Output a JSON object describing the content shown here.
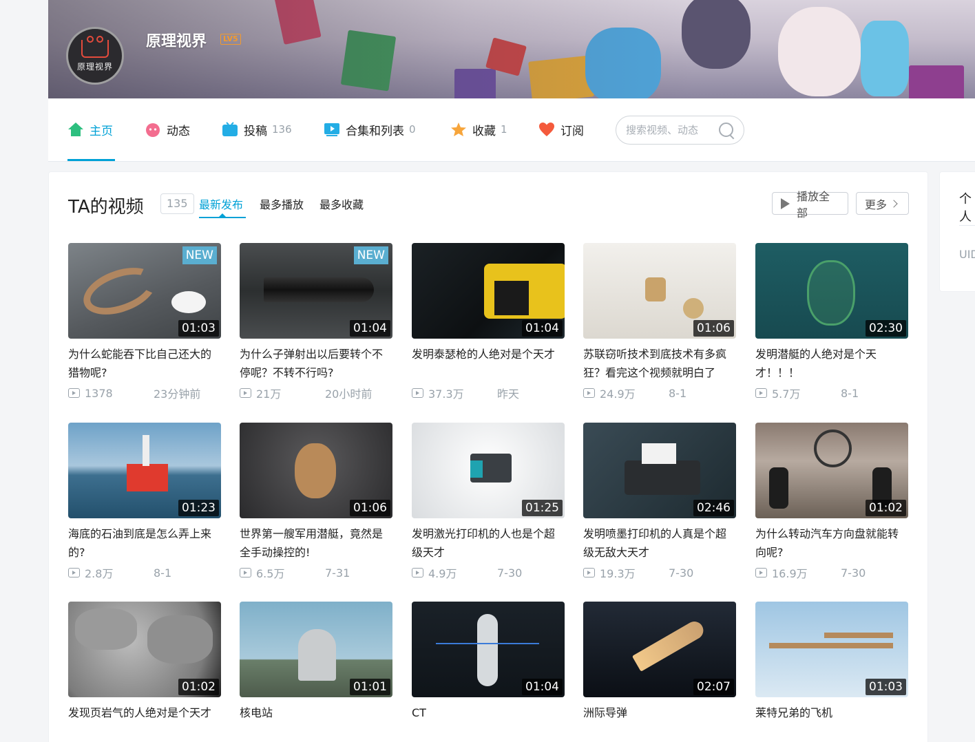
{
  "profile": {
    "name": "原理视界",
    "level": "LV5",
    "avatar_text": "原理视界"
  },
  "nav": {
    "items": [
      {
        "label": "主页",
        "count": ""
      },
      {
        "label": "动态",
        "count": ""
      },
      {
        "label": "投稿",
        "count": "136"
      },
      {
        "label": "合集和列表",
        "count": "0"
      },
      {
        "label": "收藏",
        "count": "1"
      },
      {
        "label": "订阅",
        "count": ""
      }
    ],
    "search_placeholder": "搜索视频、动态"
  },
  "videos_section": {
    "title": "TA的视频",
    "count": "135",
    "tabs": [
      "最新发布",
      "最多播放",
      "最多收藏"
    ],
    "play_all": "播放全部",
    "more": "更多"
  },
  "sidebar": {
    "title": "个人",
    "uid_label": "UID"
  },
  "videos": [
    {
      "title": "为什么蛇能吞下比自己还大的猎物呢?",
      "duration": "01:03",
      "plays": "1378",
      "date": "23分钟前",
      "badge": "NEW"
    },
    {
      "title": "为什么子弹射出以后要转个不停呢？不转不行吗?",
      "duration": "01:04",
      "plays": "21万",
      "date": "20小时前",
      "badge": "NEW"
    },
    {
      "title": "发明泰瑟枪的人绝对是个天才",
      "duration": "01:04",
      "plays": "37.3万",
      "date": "昨天",
      "badge": ""
    },
    {
      "title": "苏联窃听技术到底技术有多疯狂？看完这个视频就明白了",
      "duration": "01:06",
      "plays": "24.9万",
      "date": "8-1",
      "badge": ""
    },
    {
      "title": "发明潜艇的人绝对是个天才！！！",
      "duration": "02:30",
      "plays": "5.7万",
      "date": "8-1",
      "badge": ""
    },
    {
      "title": "海底的石油到底是怎么弄上来的?",
      "duration": "01:23",
      "plays": "2.8万",
      "date": "8-1",
      "badge": ""
    },
    {
      "title": "世界第一艘军用潜艇，竟然是全手动操控的!",
      "duration": "01:06",
      "plays": "6.5万",
      "date": "7-31",
      "badge": ""
    },
    {
      "title": "发明激光打印机的人也是个超级天才",
      "duration": "01:25",
      "plays": "4.9万",
      "date": "7-30",
      "badge": ""
    },
    {
      "title": "发明喷墨打印机的人真是个超级无敌大天才",
      "duration": "02:46",
      "plays": "19.3万",
      "date": "7-30",
      "badge": ""
    },
    {
      "title": "为什么转动汽车方向盘就能转向呢?",
      "duration": "01:02",
      "plays": "16.9万",
      "date": "7-30",
      "badge": ""
    },
    {
      "title": "发现页岩气的人绝对是个天才",
      "duration": "01:02",
      "plays": "",
      "date": "",
      "badge": ""
    },
    {
      "title": "核电站",
      "duration": "01:01",
      "plays": "",
      "date": "",
      "badge": ""
    },
    {
      "title": "CT",
      "duration": "01:04",
      "plays": "",
      "date": "",
      "badge": ""
    },
    {
      "title": "洲际导弹",
      "duration": "02:07",
      "plays": "",
      "date": "",
      "badge": ""
    },
    {
      "title": "莱特兄弟的飞机",
      "duration": "01:03",
      "plays": "",
      "date": "",
      "badge": ""
    }
  ],
  "colors": {
    "accent": "#00a1d6",
    "muted": "#99a2aa",
    "level": "#f39a2e"
  }
}
